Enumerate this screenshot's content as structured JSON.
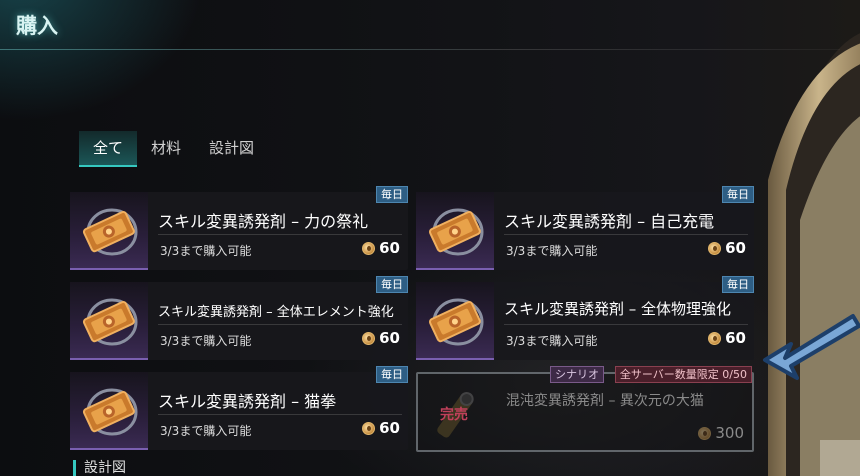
{
  "page_title": "購入",
  "tabs": [
    {
      "label": "全て",
      "active": true
    },
    {
      "label": "材料",
      "active": false
    },
    {
      "label": "設計図",
      "active": false
    }
  ],
  "items": [
    {
      "name": "スキル変異誘発剤 – 力の祭礼",
      "badge": "毎日",
      "availability": "3/3まで購入可能",
      "price": "60"
    },
    {
      "name": "スキル変異誘発剤 – 自己充電",
      "badge": "毎日",
      "availability": "3/3まで購入可能",
      "price": "60"
    },
    {
      "name": "スキル変異誘発剤 – 全体エレメント強化",
      "badge": "毎日",
      "availability": "3/3まで購入可能",
      "price": "60"
    },
    {
      "name": "スキル変異誘発剤 – 全体物理強化",
      "badge": "毎日",
      "availability": "3/3まで購入可能",
      "price": "60"
    },
    {
      "name": "スキル変異誘発剤 – 猫拳",
      "badge": "毎日",
      "availability": "3/3まで購入可能",
      "price": "60"
    }
  ],
  "sold_item": {
    "name": "混沌変異誘発剤 – 異次元の大猫",
    "tag_scenario": "シナリオ",
    "tag_limit": "全サーバー数量限定 0/50",
    "status": "完売",
    "price": "300"
  },
  "section_label": "設計図",
  "icons": {
    "coin": "currency-coin-icon",
    "item": "mutagen-ticket-icon",
    "pointer": "blue-arrow-pointer"
  },
  "colors": {
    "accent": "#35c8c0",
    "badge_bg": "#2e5e84",
    "limit_tag": "#4a1f2a",
    "arrow": "#7aa7d6"
  }
}
